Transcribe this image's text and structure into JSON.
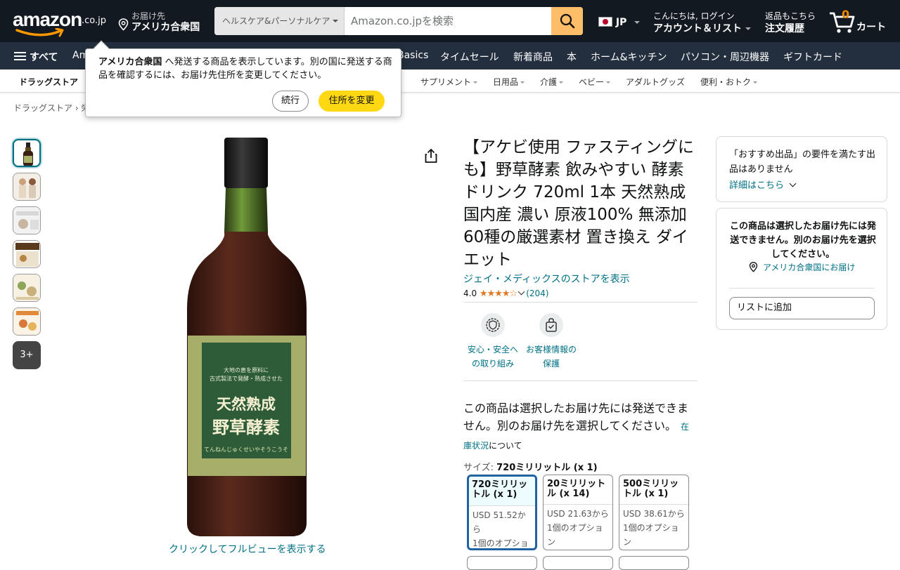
{
  "header": {
    "logo_text": "amazon",
    "logo_suffix": ".co.jp",
    "deliver_to_label": "お届け先",
    "deliver_to_value": "アメリカ合衆国",
    "search_category": "ヘルスケア&パーソナルケア",
    "search_placeholder": "Amazon.co.jpを検索",
    "language": "JP",
    "account_line1": "こんにちは, ログイン",
    "account_line2": "アカウント＆リスト",
    "orders_line1": "返品もこちら",
    "orders_line2": "注文履歴",
    "cart_count": "0",
    "cart_label": "カート"
  },
  "subnav": {
    "all_label": "すべて",
    "items": [
      "Am",
      "Basics",
      "タイムセール",
      "新着商品",
      "本",
      "ホーム&キッチン",
      "パソコン・周辺機器",
      "ギフトカード"
    ]
  },
  "category_bar": {
    "title": "ドラッグストア",
    "items": [
      "サプリメント",
      "日用品",
      "介護",
      "ベビー",
      "アダルトグッズ",
      "便利・おトク"
    ]
  },
  "breadcrumb": "ドラッグストア › 栄",
  "popover": {
    "country": "アメリカ合衆国",
    "message": " へ発送する商品を表示しています。別の国に発送する商品を確認するには、お届け先住所を変更してください。",
    "continue_label": "続行",
    "change_label": "住所を変更"
  },
  "gallery": {
    "more_label": "3+",
    "fullview_label": "クリックしてフルビューを表示する",
    "label_line1": "大地の恵を原料に",
    "label_line2": "古式製法で発酵・熟成させた",
    "label_title1": "天然熟成",
    "label_title2": "野草酵素",
    "label_reading": "てんねんじゅくせいやそうこうそ"
  },
  "product": {
    "title": "【アケビ使用 ファスティングにも】野草酵素 飲みやすい 酵素ドリンク 720ml 1本 天然熟成 国内産 濃い 原液100% 無添加 60種の厳選素材 置き換え ダイエット",
    "store_link": "ジェイ・メディックスのストアを表示",
    "rating_value": "4.0",
    "stars": "★★★★☆",
    "rating_count": "(204)",
    "badges": [
      {
        "line1": "安心・安全へ",
        "line2": "の取り組み"
      },
      {
        "line1": "お客様情報の",
        "line2": "保護"
      }
    ],
    "unavailable_text": "この商品は選択したお届け先には発送できません。別のお届け先を選択してください。",
    "stock_link": "在庫状況",
    "stock_suffix": "について",
    "size_label": "サイズ: ",
    "size_value": "720ミリリットル (x 1)",
    "sizes": [
      {
        "name": "720ミリリットル (x 1)",
        "price": "USD 51.52から",
        "options": "1個のオプション"
      },
      {
        "name": "20ミリリットル (x 14)",
        "price": "USD 21.63から",
        "options": "1個のオプション"
      },
      {
        "name": "500ミリリットル (x 1)",
        "price": "USD 38.61から",
        "options": "1個のオプション"
      }
    ]
  },
  "buybox": {
    "recommend_text": "「おすすめ出品」の要件を満たす出品はありません",
    "details_link": "詳細はこちら",
    "warn_text": "この商品は選択したお届け先には発送できません。別のお届け先を選択してください。",
    "ship_to": "アメリカ合衆国にお届け",
    "add_to_list": "リストに追加"
  },
  "colors": {
    "nav_bg": "#131921",
    "subnav_bg": "#232f3e",
    "link": "#007185",
    "button_yellow": "#ffd814",
    "search_button": "#febd69"
  }
}
